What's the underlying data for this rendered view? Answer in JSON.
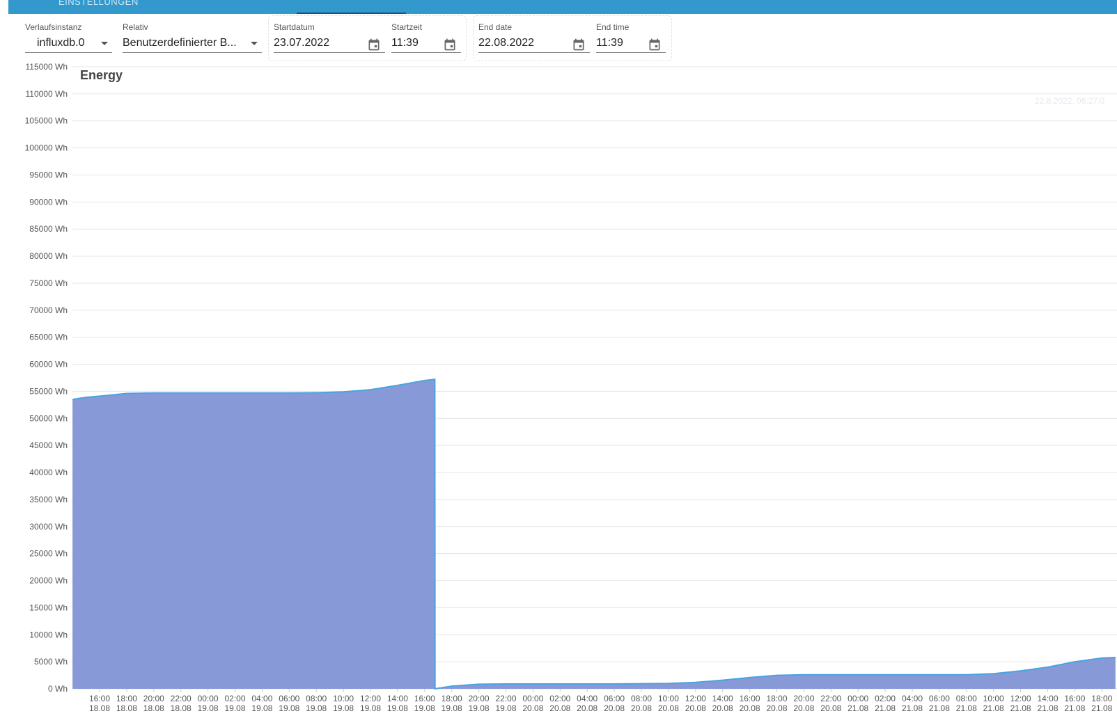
{
  "header": {
    "tab_label": "EINSTELLUNGEN"
  },
  "controls": {
    "instance": {
      "label": "Verlaufsinstanz",
      "value": "influxdb.0"
    },
    "relative": {
      "label": "Relativ",
      "value": "Benutzerdefinierter B..."
    },
    "start_date": {
      "label": "Startdatum",
      "value": "23.07.2022"
    },
    "start_time": {
      "label": "Startzeit",
      "value": "11:39"
    },
    "end_date": {
      "label": "End date",
      "value": "22.08.2022"
    },
    "end_time": {
      "label": "End time",
      "value": "11:39"
    }
  },
  "icons": {
    "dropdown": "chevron-down-icon",
    "calendar": "calendar-icon"
  },
  "colors": {
    "header": "#3399cc",
    "area_fill": "#8899d8",
    "area_line": "#4aa3df"
  },
  "chart_data": {
    "type": "area",
    "title": "Energy",
    "tooltip": "22.8.2022, 06:27:0",
    "xlabel": "",
    "ylabel": "",
    "ylim": [
      0,
      115000
    ],
    "y_ticks": [
      "0 Wh",
      "5000 Wh",
      "10000 Wh",
      "15000 Wh",
      "20000 Wh",
      "25000 Wh",
      "30000 Wh",
      "35000 Wh",
      "40000 Wh",
      "45000 Wh",
      "50000 Wh",
      "55000 Wh",
      "60000 Wh",
      "65000 Wh",
      "70000 Wh",
      "75000 Wh",
      "80000 Wh",
      "85000 Wh",
      "90000 Wh",
      "95000 Wh",
      "100000 Wh",
      "105000 Wh",
      "110000 Wh",
      "115000 Wh"
    ],
    "x_ticks": [
      [
        "16:00",
        "18.08"
      ],
      [
        "18:00",
        "18.08"
      ],
      [
        "20:00",
        "18.08"
      ],
      [
        "22:00",
        "18.08"
      ],
      [
        "00:00",
        "19.08"
      ],
      [
        "02:00",
        "19.08"
      ],
      [
        "04:00",
        "19.08"
      ],
      [
        "06:00",
        "19.08"
      ],
      [
        "08:00",
        "19.08"
      ],
      [
        "10:00",
        "19.08"
      ],
      [
        "12:00",
        "19.08"
      ],
      [
        "14:00",
        "19.08"
      ],
      [
        "16:00",
        "19.08"
      ],
      [
        "18:00",
        "19.08"
      ],
      [
        "20:00",
        "19.08"
      ],
      [
        "22:00",
        "19.08"
      ],
      [
        "00:00",
        "20.08"
      ],
      [
        "02:00",
        "20.08"
      ],
      [
        "04:00",
        "20.08"
      ],
      [
        "06:00",
        "20.08"
      ],
      [
        "08:00",
        "20.08"
      ],
      [
        "10:00",
        "20.08"
      ],
      [
        "12:00",
        "20.08"
      ],
      [
        "14:00",
        "20.08"
      ],
      [
        "16:00",
        "20.08"
      ],
      [
        "18:00",
        "20.08"
      ],
      [
        "20:00",
        "20.08"
      ],
      [
        "22:00",
        "20.08"
      ],
      [
        "00:00",
        "21.08"
      ],
      [
        "02:00",
        "21.08"
      ],
      [
        "04:00",
        "21.08"
      ],
      [
        "06:00",
        "21.08"
      ],
      [
        "08:00",
        "21.08"
      ],
      [
        "10:00",
        "21.08"
      ],
      [
        "12:00",
        "21.08"
      ],
      [
        "14:00",
        "21.08"
      ],
      [
        "16:00",
        "21.08"
      ],
      [
        "18:00",
        "21.08"
      ]
    ],
    "series": [
      {
        "points": [
          [
            "18.08 14:00",
            53500
          ],
          [
            "18.08 15:00",
            53900
          ],
          [
            "18.08 16:00",
            54100
          ],
          [
            "18.08 18:00",
            54600
          ],
          [
            "18.08 20:00",
            54700
          ],
          [
            "18.08 22:00",
            54700
          ],
          [
            "19.08 00:00",
            54700
          ],
          [
            "19.08 02:00",
            54700
          ],
          [
            "19.08 04:00",
            54700
          ],
          [
            "19.08 06:00",
            54700
          ],
          [
            "19.08 08:00",
            54750
          ],
          [
            "19.08 10:00",
            54900
          ],
          [
            "19.08 12:00",
            55300
          ],
          [
            "19.08 14:00",
            56100
          ],
          [
            "19.08 16:00",
            57000
          ],
          [
            "19.08 16:45",
            57200
          ],
          [
            "19.08 16:46",
            0
          ],
          [
            "19.08 17:00",
            100
          ],
          [
            "19.08 18:00",
            500
          ],
          [
            "19.08 20:00",
            850
          ],
          [
            "19.08 22:00",
            900
          ],
          [
            "20.08 00:00",
            900
          ],
          [
            "20.08 02:00",
            900
          ],
          [
            "20.08 04:00",
            900
          ],
          [
            "20.08 06:00",
            900
          ],
          [
            "20.08 08:00",
            950
          ],
          [
            "20.08 10:00",
            1000
          ],
          [
            "20.08 12:00",
            1200
          ],
          [
            "20.08 14:00",
            1600
          ],
          [
            "20.08 16:00",
            2100
          ],
          [
            "20.08 18:00",
            2500
          ],
          [
            "20.08 20:00",
            2600
          ],
          [
            "20.08 22:00",
            2600
          ],
          [
            "21.08 00:00",
            2600
          ],
          [
            "21.08 02:00",
            2600
          ],
          [
            "21.08 04:00",
            2600
          ],
          [
            "21.08 06:00",
            2600
          ],
          [
            "21.08 08:00",
            2600
          ],
          [
            "21.08 10:00",
            2800
          ],
          [
            "21.08 12:00",
            3300
          ],
          [
            "21.08 14:00",
            4000
          ],
          [
            "21.08 16:00",
            5000
          ],
          [
            "21.08 18:00",
            5700
          ],
          [
            "21.08 19:00",
            5800
          ]
        ]
      }
    ],
    "grid": true,
    "legend": "none"
  }
}
